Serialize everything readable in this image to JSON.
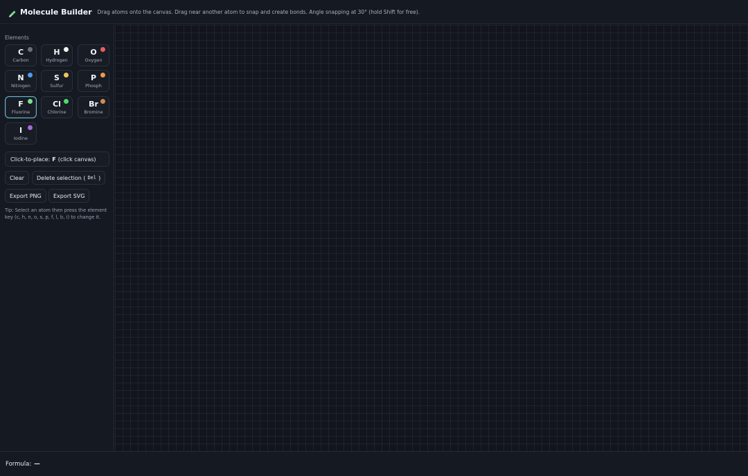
{
  "header": {
    "title": "Molecule Builder",
    "subtitle": "Drag atoms onto the canvas. Drag near another atom to snap and create bonds. Angle snapping at 30° (hold Shift for free)."
  },
  "sidebar": {
    "section_label": "Elements",
    "elements": [
      {
        "symbol": "C",
        "name": "Carbon",
        "color": "#6b6f78",
        "selected": false
      },
      {
        "symbol": "H",
        "name": "Hydrogen",
        "color": "#f2f2f2",
        "selected": false
      },
      {
        "symbol": "O",
        "name": "Oxygen",
        "color": "#ef5b5b",
        "selected": false
      },
      {
        "symbol": "N",
        "name": "Nitrogen",
        "color": "#4e9cf0",
        "selected": false
      },
      {
        "symbol": "S",
        "name": "Sulfur",
        "color": "#f2c45c",
        "selected": false
      },
      {
        "symbol": "P",
        "name": "Phosph",
        "color": "#f29a4a",
        "selected": false
      },
      {
        "symbol": "F",
        "name": "Fluorine",
        "color": "#7ee08a",
        "selected": true
      },
      {
        "symbol": "Cl",
        "name": "Chlorine",
        "color": "#4fdb6a",
        "selected": false
      },
      {
        "symbol": "Br",
        "name": "Bromine",
        "color": "#d48a52",
        "selected": false
      },
      {
        "symbol": "I",
        "name": "Iodine",
        "color": "#a56bd6",
        "selected": false
      }
    ],
    "place_prefix": "Click-to-place:",
    "place_symbol": "F",
    "place_suffix": "(click canvas)",
    "clear_label": "Clear",
    "delete_label": "Delete selection (",
    "delete_key": "Del",
    "delete_close": ")",
    "export_png_label": "Export PNG",
    "export_svg_label": "Export SVG",
    "tip": "Tip: Select an atom then press the element key (c, h, n, o, s, p, f, l, b, i) to change it."
  },
  "footer": {
    "formula_label": "Formula:",
    "formula_value": "—"
  },
  "colors": {
    "accent": "#6fb3c9",
    "pencil": "#7ee08a"
  }
}
